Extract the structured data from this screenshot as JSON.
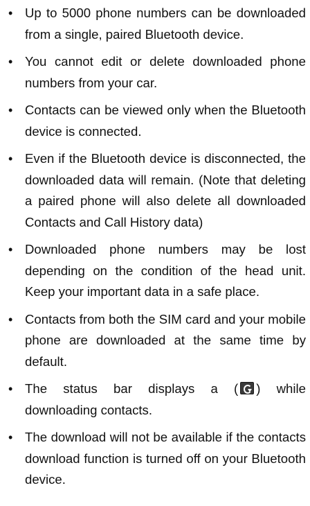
{
  "bullets": [
    "Up to 5000 phone numbers can be downloaded from a single, paired Bluetooth device.",
    "You cannot edit or delete downloaded phone numbers from your car.",
    "Contacts can be viewed only when the Bluetooth device is connected.",
    "Even if the Bluetooth device is disconnected, the downloaded data will remain. (Note that deleting a paired phone will also delete all downloaded Contacts and Call History data)",
    "Downloaded phone numbers may be lost depending on the condition of the head unit. Keep your important data in a safe place.",
    "Contacts from both the SIM card and your mobile phone are downloaded at the same time by default.",
    {
      "before": "The status bar displays a (",
      "icon": "contacts-download-icon",
      "after": ") while downloading contacts."
    },
    "The download will not be available if the contacts download function is turned off on your Bluetooth device."
  ],
  "bullet_symbol": "•"
}
